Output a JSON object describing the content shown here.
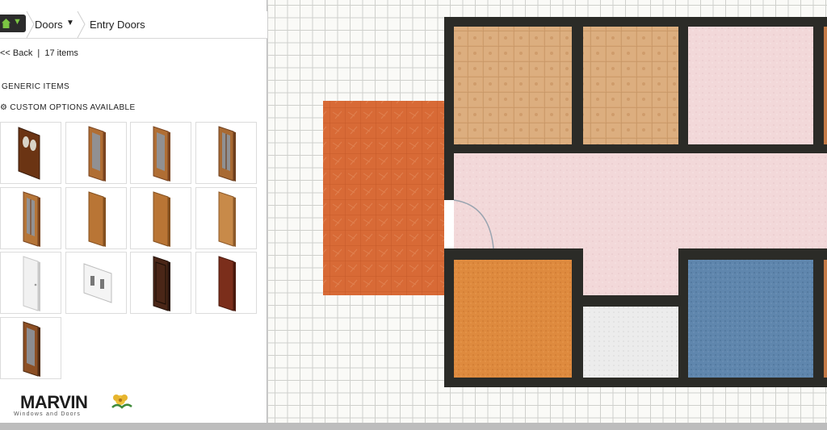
{
  "breadcrumb": {
    "category": "Doors",
    "subcategory": "Entry Doors"
  },
  "listing": {
    "back_label": "<< Back",
    "separator": "|",
    "count_label": "17 items"
  },
  "sections": {
    "generic_label": "GENERIC ITEMS",
    "custom_label": "CUSTOM OPTIONS AVAILABLE"
  },
  "catalog_items": [
    {
      "style": "double-arched-dark"
    },
    {
      "style": "wood-glass-narrow"
    },
    {
      "style": "wood-glass-narrow"
    },
    {
      "style": "wood-double-glass"
    },
    {
      "style": "wood-multi-lite"
    },
    {
      "style": "wood-panel"
    },
    {
      "style": "wood-panel"
    },
    {
      "style": "wood-panel-light"
    },
    {
      "style": "white-slab"
    },
    {
      "style": "white-double-lite"
    },
    {
      "style": "dark-paneled"
    },
    {
      "style": "mahogany-slab"
    },
    {
      "style": "wood-glass-dark"
    }
  ],
  "brand": {
    "name": "MARVIN",
    "tagline": "Windows and Doors"
  },
  "colors": {
    "accent_green": "#7bc443",
    "wall": "#2b2b27",
    "floor_tile_beige": "#d9a877",
    "floor_pink": "#f2d8d9",
    "floor_terracotta": "#d86a36",
    "floor_orange": "#de8a3e",
    "floor_blue": "#5f86ad",
    "floor_white": "#ececec"
  }
}
